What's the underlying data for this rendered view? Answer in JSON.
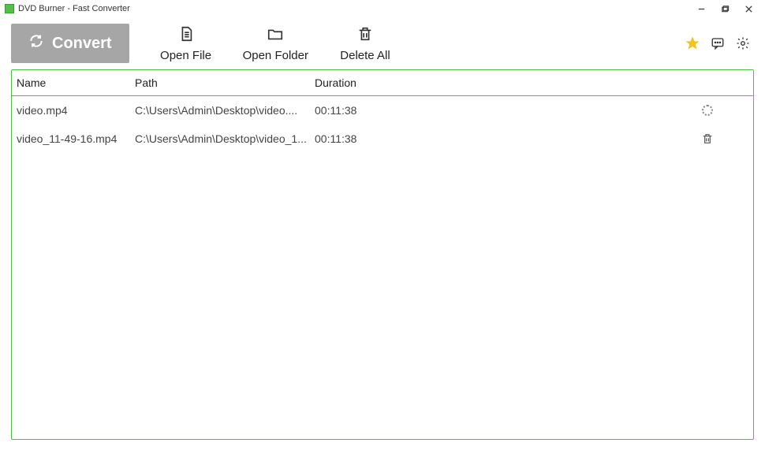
{
  "window": {
    "title": "DVD Burner - Fast Converter"
  },
  "toolbar": {
    "convert_label": "Convert",
    "open_file_label": "Open File",
    "open_folder_label": "Open Folder",
    "delete_all_label": "Delete All"
  },
  "table": {
    "headers": {
      "name": "Name",
      "path": "Path",
      "duration": "Duration"
    },
    "rows": [
      {
        "name": "video.mp4",
        "path": "C:\\Users\\Admin\\Desktop\\video....",
        "duration": "00:11:38",
        "status": "loading"
      },
      {
        "name": "video_11-49-16.mp4",
        "path": "C:\\Users\\Admin\\Desktop\\video_1...",
        "duration": "00:11:38",
        "status": "deletable"
      }
    ]
  }
}
